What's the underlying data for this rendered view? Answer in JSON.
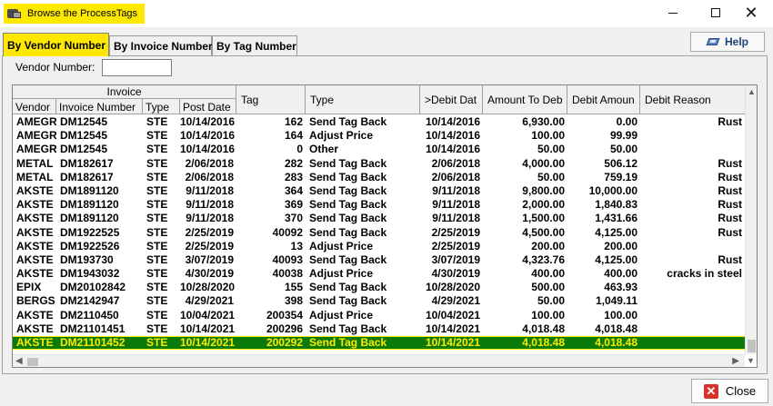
{
  "window": {
    "title": "Browse the ProcessTags",
    "minimize": "—",
    "maximize": "",
    "close": "✕"
  },
  "tabs": [
    {
      "label": "By Vendor Number",
      "active": true
    },
    {
      "label": "By Invoice Number",
      "active": false
    },
    {
      "label": "By Tag Number",
      "active": false
    }
  ],
  "help": {
    "label": "Help"
  },
  "filter": {
    "label": "Vendor Number:",
    "value": ""
  },
  "grid": {
    "group_header": "Invoice",
    "headers": {
      "vendor": "Vendor",
      "invoice_number": "Invoice Number",
      "type": "Type",
      "post_date": "Post Date",
      "tag": "Tag",
      "tag_type": "Type",
      "debit_date": ">Debit Dat",
      "amount_to_debit": "Amount To Deb",
      "debit_amount": "Debit Amoun",
      "debit_reason": "Debit Reason"
    },
    "rows": [
      {
        "vendor": "AMEGR",
        "invoice": "DM12545",
        "type": "STE",
        "post_date": "10/14/2016",
        "tag": "162",
        "tag_type": "Send Tag Back",
        "debit_date": "10/14/2016",
        "amount_to_debit": "6,930.00",
        "debit_amount": "0.00",
        "reason": "Rust",
        "selected": false
      },
      {
        "vendor": "AMEGR",
        "invoice": "DM12545",
        "type": "STE",
        "post_date": "10/14/2016",
        "tag": "164",
        "tag_type": "Adjust Price",
        "debit_date": "10/14/2016",
        "amount_to_debit": "100.00",
        "debit_amount": "99.99",
        "reason": "",
        "selected": false
      },
      {
        "vendor": "AMEGR",
        "invoice": "DM12545",
        "type": "STE",
        "post_date": "10/14/2016",
        "tag": "0",
        "tag_type": "Other",
        "debit_date": "10/14/2016",
        "amount_to_debit": "50.00",
        "debit_amount": "50.00",
        "reason": "",
        "selected": false
      },
      {
        "vendor": "METAL",
        "invoice": "DM182617",
        "type": "STE",
        "post_date": "2/06/2018",
        "tag": "282",
        "tag_type": "Send Tag Back",
        "debit_date": "2/06/2018",
        "amount_to_debit": "4,000.00",
        "debit_amount": "506.12",
        "reason": "Rust",
        "selected": false
      },
      {
        "vendor": "METAL",
        "invoice": "DM182617",
        "type": "STE",
        "post_date": "2/06/2018",
        "tag": "283",
        "tag_type": "Send Tag Back",
        "debit_date": "2/06/2018",
        "amount_to_debit": "50.00",
        "debit_amount": "759.19",
        "reason": "Rust",
        "selected": false
      },
      {
        "vendor": "AKSTE",
        "invoice": "DM1891120",
        "type": "STE",
        "post_date": "9/11/2018",
        "tag": "364",
        "tag_type": "Send Tag Back",
        "debit_date": "9/11/2018",
        "amount_to_debit": "9,800.00",
        "debit_amount": "10,000.00",
        "reason": "Rust",
        "selected": false
      },
      {
        "vendor": "AKSTE",
        "invoice": "DM1891120",
        "type": "STE",
        "post_date": "9/11/2018",
        "tag": "369",
        "tag_type": "Send Tag Back",
        "debit_date": "9/11/2018",
        "amount_to_debit": "2,000.00",
        "debit_amount": "1,840.83",
        "reason": "Rust",
        "selected": false
      },
      {
        "vendor": "AKSTE",
        "invoice": "DM1891120",
        "type": "STE",
        "post_date": "9/11/2018",
        "tag": "370",
        "tag_type": "Send Tag Back",
        "debit_date": "9/11/2018",
        "amount_to_debit": "1,500.00",
        "debit_amount": "1,431.66",
        "reason": "Rust",
        "selected": false
      },
      {
        "vendor": "AKSTE",
        "invoice": "DM1922525",
        "type": "STE",
        "post_date": "2/25/2019",
        "tag": "40092",
        "tag_type": "Send Tag Back",
        "debit_date": "2/25/2019",
        "amount_to_debit": "4,500.00",
        "debit_amount": "4,125.00",
        "reason": "Rust",
        "selected": false
      },
      {
        "vendor": "AKSTE",
        "invoice": "DM1922526",
        "type": "STE",
        "post_date": "2/25/2019",
        "tag": "13",
        "tag_type": "Adjust Price",
        "debit_date": "2/25/2019",
        "amount_to_debit": "200.00",
        "debit_amount": "200.00",
        "reason": "",
        "selected": false
      },
      {
        "vendor": "AKSTE",
        "invoice": "DM193730",
        "type": "STE",
        "post_date": "3/07/2019",
        "tag": "40093",
        "tag_type": "Send Tag Back",
        "debit_date": "3/07/2019",
        "amount_to_debit": "4,323.76",
        "debit_amount": "4,125.00",
        "reason": "Rust",
        "selected": false
      },
      {
        "vendor": "AKSTE",
        "invoice": "DM1943032",
        "type": "STE",
        "post_date": "4/30/2019",
        "tag": "40038",
        "tag_type": "Adjust Price",
        "debit_date": "4/30/2019",
        "amount_to_debit": "400.00",
        "debit_amount": "400.00",
        "reason": "cracks in steel",
        "selected": false
      },
      {
        "vendor": "EPIX",
        "invoice": "DM20102842",
        "type": "STE",
        "post_date": "10/28/2020",
        "tag": "155",
        "tag_type": "Send Tag Back",
        "debit_date": "10/28/2020",
        "amount_to_debit": "500.00",
        "debit_amount": "463.93",
        "reason": "",
        "selected": false
      },
      {
        "vendor": "BERGS",
        "invoice": "DM2142947",
        "type": "STE",
        "post_date": "4/29/2021",
        "tag": "398",
        "tag_type": "Send Tag Back",
        "debit_date": "4/29/2021",
        "amount_to_debit": "50.00",
        "debit_amount": "1,049.11",
        "reason": "",
        "selected": false
      },
      {
        "vendor": "AKSTE",
        "invoice": "DM2110450",
        "type": "STE",
        "post_date": "10/04/2021",
        "tag": "200354",
        "tag_type": "Adjust Price",
        "debit_date": "10/04/2021",
        "amount_to_debit": "100.00",
        "debit_amount": "100.00",
        "reason": "",
        "selected": false
      },
      {
        "vendor": "AKSTE",
        "invoice": "DM21101451",
        "type": "STE",
        "post_date": "10/14/2021",
        "tag": "200296",
        "tag_type": "Send Tag Back",
        "debit_date": "10/14/2021",
        "amount_to_debit": "4,018.48",
        "debit_amount": "4,018.48",
        "reason": "",
        "selected": false
      },
      {
        "vendor": "AKSTE",
        "invoice": "DM21101452",
        "type": "STE",
        "post_date": "10/14/2021",
        "tag": "200292",
        "tag_type": "Send Tag Back",
        "debit_date": "10/14/2021",
        "amount_to_debit": "4,018.48",
        "debit_amount": "4,018.48",
        "reason": "",
        "selected": true
      }
    ]
  },
  "scroll": {
    "up": "▲",
    "down": "▼",
    "left": "◀",
    "right": "▶"
  },
  "footer": {
    "close_label": "Close",
    "close_glyph": "✕"
  },
  "colors": {
    "highlight_yellow": "#ffe800",
    "selected_row": "#0b7a0b",
    "close_red": "#d8322c"
  }
}
